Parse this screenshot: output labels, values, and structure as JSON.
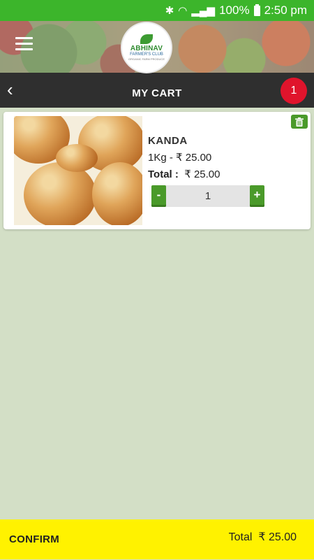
{
  "status_bar": {
    "battery": "100%",
    "time": "2:50 pm"
  },
  "header": {
    "logo": {
      "line1": "ABHINAV",
      "line2": "FARMER'S CLUB",
      "line3": "ORGANIC FARM PRODUCE"
    },
    "menu_icon": "hamburger-icon"
  },
  "titlebar": {
    "title": "MY CART",
    "back_icon": "chevron-left-icon",
    "cart_count": "1"
  },
  "cart": {
    "items": [
      {
        "name": "KANDA",
        "unit_price": "1Kg - ₹ 25.00",
        "total_label": "Total :",
        "total_value": "₹ 25.00",
        "quantity": "1",
        "minus_label": "-",
        "plus_label": "+"
      }
    ]
  },
  "footer": {
    "confirm_label": "CONFIRM",
    "total_label": "Total",
    "total_value": "₹ 25.00"
  },
  "colors": {
    "status_bar": "#3cb52b",
    "titlebar": "#2f2f2f",
    "badge": "#e0142c",
    "accent_green": "#4a9a2a",
    "footer": "#fff200",
    "background": "#d3dfc6"
  }
}
